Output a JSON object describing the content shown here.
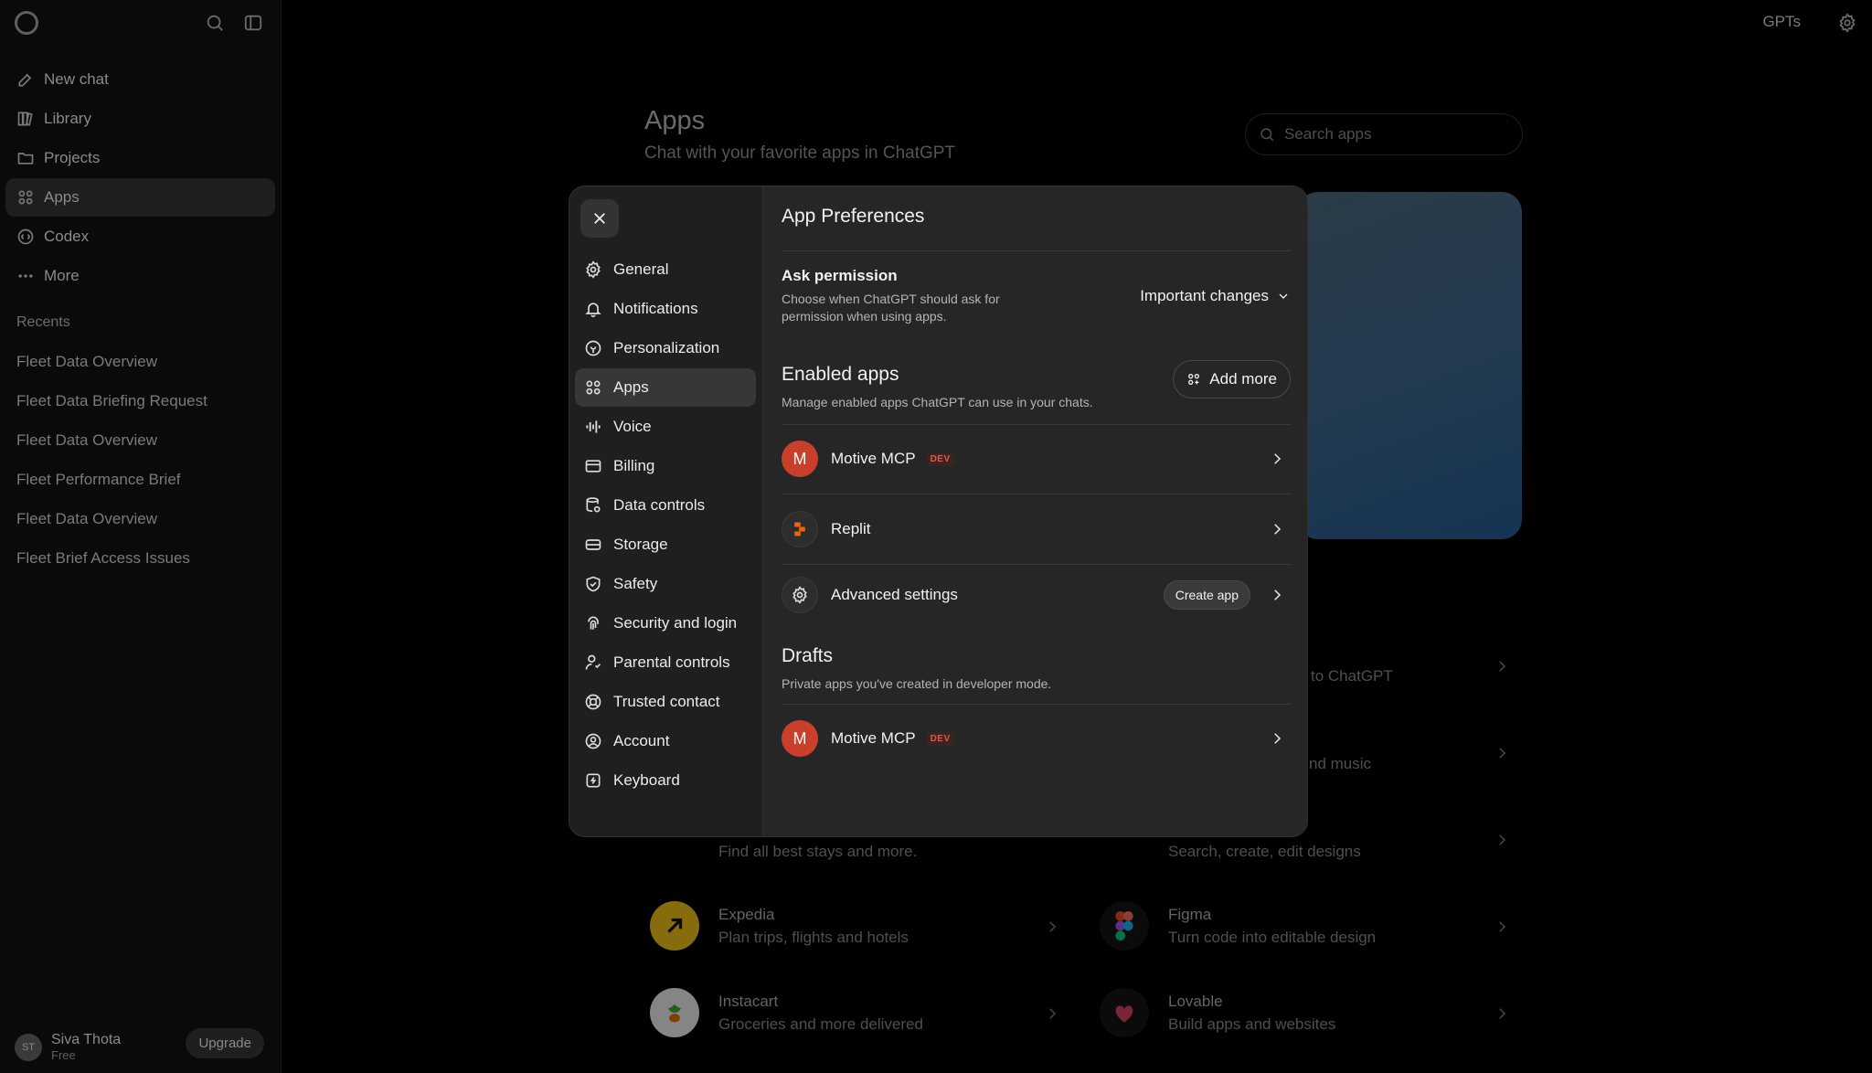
{
  "sidebar": {
    "nav": [
      {
        "label": "New chat",
        "icon": "new-chat-icon"
      },
      {
        "label": "Library",
        "icon": "library-icon"
      },
      {
        "label": "Projects",
        "icon": "folder-icon"
      },
      {
        "label": "Apps",
        "icon": "apps-icon",
        "active": true
      },
      {
        "label": "Codex",
        "icon": "codex-icon"
      },
      {
        "label": "More",
        "icon": "more-icon"
      }
    ],
    "recents_title": "Recents",
    "recents": [
      "Fleet Data Overview",
      "Fleet Data Briefing Request",
      "Fleet Data Overview",
      "Fleet Performance Brief",
      "Fleet Data Overview",
      "Fleet Brief Access Issues"
    ],
    "user": {
      "initials": "ST",
      "name": "Siva Thota",
      "plan": "Free"
    },
    "upgrade_label": "Upgrade"
  },
  "topbar": {
    "gpts_label": "GPTs"
  },
  "main": {
    "title": "Apps",
    "subtitle": "Chat with your favorite apps in ChatGPT",
    "search_placeholder": "Search apps",
    "fragments": {
      "right_row1": "to ChatGPT",
      "right_row2": "nd music",
      "left_row3": "Find all best stays and more.",
      "right_row3": "Search, create, edit designs"
    },
    "apps": [
      {
        "name": "Expedia",
        "desc": "Plan trips, flights and hotels"
      },
      {
        "name": "Figma",
        "desc": "Turn code into editable design"
      },
      {
        "name": "Instacart",
        "desc": "Groceries and more delivered"
      },
      {
        "name": "Lovable",
        "desc": "Build apps and websites"
      }
    ]
  },
  "modal": {
    "nav": [
      {
        "label": "General",
        "icon": "gear-icon"
      },
      {
        "label": "Notifications",
        "icon": "bell-icon"
      },
      {
        "label": "Personalization",
        "icon": "personalization-icon"
      },
      {
        "label": "Apps",
        "icon": "apps-icon",
        "active": true
      },
      {
        "label": "Voice",
        "icon": "voice-icon"
      },
      {
        "label": "Billing",
        "icon": "billing-icon"
      },
      {
        "label": "Data controls",
        "icon": "data-controls-icon"
      },
      {
        "label": "Storage",
        "icon": "storage-icon"
      },
      {
        "label": "Safety",
        "icon": "shield-icon"
      },
      {
        "label": "Security and login",
        "icon": "fingerprint-icon"
      },
      {
        "label": "Parental controls",
        "icon": "parental-icon"
      },
      {
        "label": "Trusted contact",
        "icon": "lifebuoy-icon"
      },
      {
        "label": "Account",
        "icon": "account-icon"
      },
      {
        "label": "Keyboard",
        "icon": "keyboard-icon"
      }
    ],
    "title": "App Preferences",
    "permission": {
      "title": "Ask permission",
      "desc": "Choose when ChatGPT should ask for permission when using apps.",
      "value": "Important changes"
    },
    "enabled": {
      "title": "Enabled apps",
      "desc": "Manage enabled apps ChatGPT can use in your chats.",
      "add_label": "Add more"
    },
    "rows": {
      "motive": {
        "initial": "M",
        "name": "Motive MCP",
        "badge": "DEV"
      },
      "replit": {
        "name": "Replit"
      },
      "advanced": {
        "name": "Advanced settings",
        "button": "Create app"
      }
    },
    "drafts": {
      "title": "Drafts",
      "desc": "Private apps you've created in developer mode.",
      "item": {
        "initial": "M",
        "name": "Motive MCP",
        "badge": "DEV"
      }
    }
  },
  "colors": {
    "accent_motive": "#c8402c",
    "dev_badge": "#d95b4b",
    "replit": "#f26207"
  }
}
